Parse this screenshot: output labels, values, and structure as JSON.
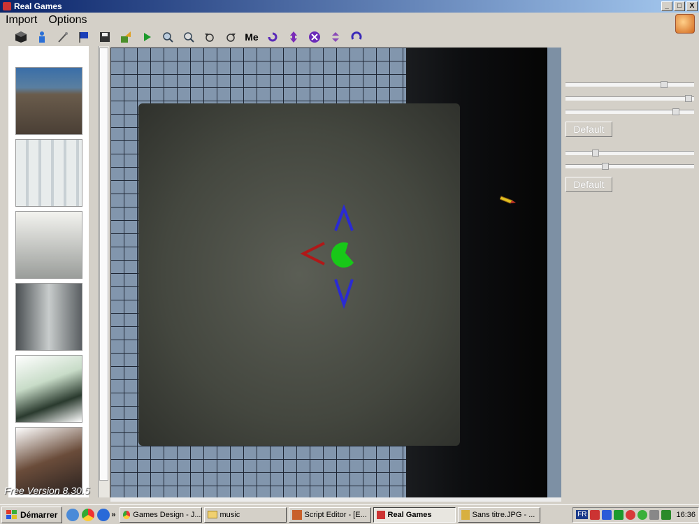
{
  "window": {
    "title": "Real Games"
  },
  "titlebar_controls": {
    "minimize": "_",
    "maximize": "□",
    "close": "X"
  },
  "menu": [
    "Import",
    "Options"
  ],
  "toolbar": [
    "cube-icon",
    "person-icon",
    "magic-wand-icon",
    "flag-icon",
    "save-icon",
    "export-icon",
    "play-icon",
    "zoom-in-icon",
    "zoom-out-icon",
    "rotate-left-icon",
    "rotate-right-icon",
    "me-icon",
    "rotate-arrow-icon",
    "vertical-arrows-icon",
    "close-circle-icon",
    "updown-icon",
    "undo-arrow-icon"
  ],
  "toolbar_me_label": "Me",
  "side_panel": {
    "version": "Free Version 8.30.5"
  },
  "right_panel": {
    "default1": "Default",
    "default2": "Default"
  },
  "sliders": [
    0.78,
    0.98,
    0.88,
    0.22,
    0.3
  ],
  "taskbar": {
    "start": "Démarrer",
    "chevron": "»",
    "tasks": [
      {
        "label": "Games Design - J...",
        "active": false
      },
      {
        "label": "music",
        "active": false
      },
      {
        "label": "Script Editor - [E...",
        "active": false
      },
      {
        "label": "Real Games",
        "active": true
      },
      {
        "label": "Sans titre.JPG - ...",
        "active": false
      }
    ],
    "lang": "FR",
    "clock": "16:36"
  },
  "colors": {
    "titlebar": "#0a246a",
    "gizmo_blue": "#2a2ad4",
    "gizmo_red": "#b01818",
    "gizmo_green": "#18c818"
  }
}
